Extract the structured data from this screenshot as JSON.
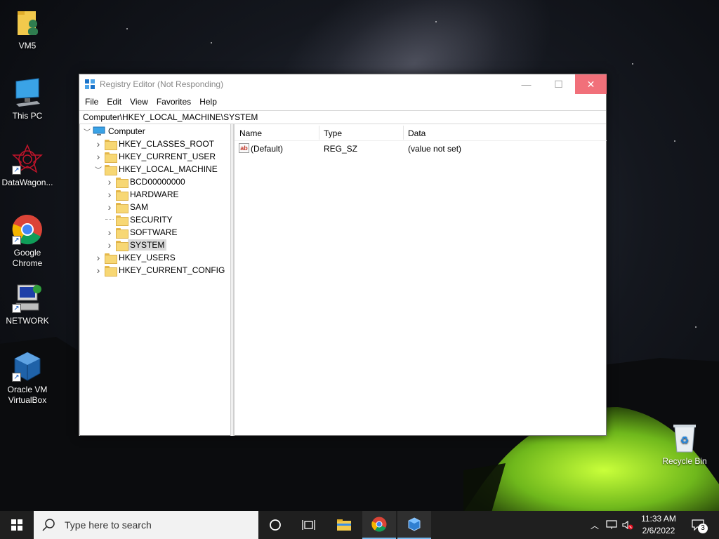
{
  "desktop": {
    "icons": [
      {
        "label": "VM5"
      },
      {
        "label": "This PC"
      },
      {
        "label": "DataWagon..."
      },
      {
        "label": "Google Chrome"
      },
      {
        "label": "NETWORK"
      },
      {
        "label": "Oracle VM VirtualBox"
      },
      {
        "label": "Recycle Bin"
      }
    ]
  },
  "window": {
    "title": "Registry Editor (Not Responding)",
    "controls": {
      "minimize": "—",
      "maximize": "☐",
      "close": "✕"
    },
    "menu": [
      "File",
      "Edit",
      "View",
      "Favorites",
      "Help"
    ],
    "address": "Computer\\HKEY_LOCAL_MACHINE\\SYSTEM",
    "tree": {
      "root": "Computer",
      "items": [
        {
          "label": "HKEY_CLASSES_ROOT",
          "depth": 1,
          "expander": "collapsed"
        },
        {
          "label": "HKEY_CURRENT_USER",
          "depth": 1,
          "expander": "collapsed"
        },
        {
          "label": "HKEY_LOCAL_MACHINE",
          "depth": 1,
          "expander": "expanded"
        },
        {
          "label": "BCD00000000",
          "depth": 2,
          "expander": "collapsed"
        },
        {
          "label": "HARDWARE",
          "depth": 2,
          "expander": "collapsed"
        },
        {
          "label": "SAM",
          "depth": 2,
          "expander": "collapsed"
        },
        {
          "label": "SECURITY",
          "depth": 2,
          "expander": "none"
        },
        {
          "label": "SOFTWARE",
          "depth": 2,
          "expander": "collapsed"
        },
        {
          "label": "SYSTEM",
          "depth": 2,
          "expander": "collapsed",
          "selected": true
        },
        {
          "label": "HKEY_USERS",
          "depth": 1,
          "expander": "collapsed"
        },
        {
          "label": "HKEY_CURRENT_CONFIG",
          "depth": 1,
          "expander": "collapsed"
        }
      ]
    },
    "list": {
      "columns": [
        "Name",
        "Type",
        "Data"
      ],
      "rows": [
        {
          "icon": "string-value-icon",
          "icon_text": "ab",
          "name": "(Default)",
          "type": "REG_SZ",
          "data": "(value not set)"
        }
      ]
    }
  },
  "taskbar": {
    "search_placeholder": "Type here to search",
    "time": "11:33 AM",
    "date": "2/6/2022",
    "notification_count": "3"
  },
  "colors": {
    "close_button": "#f1707a",
    "taskbar": "#1f1f1f",
    "folder": "#f7d774",
    "selection": "#d9d9d9"
  }
}
